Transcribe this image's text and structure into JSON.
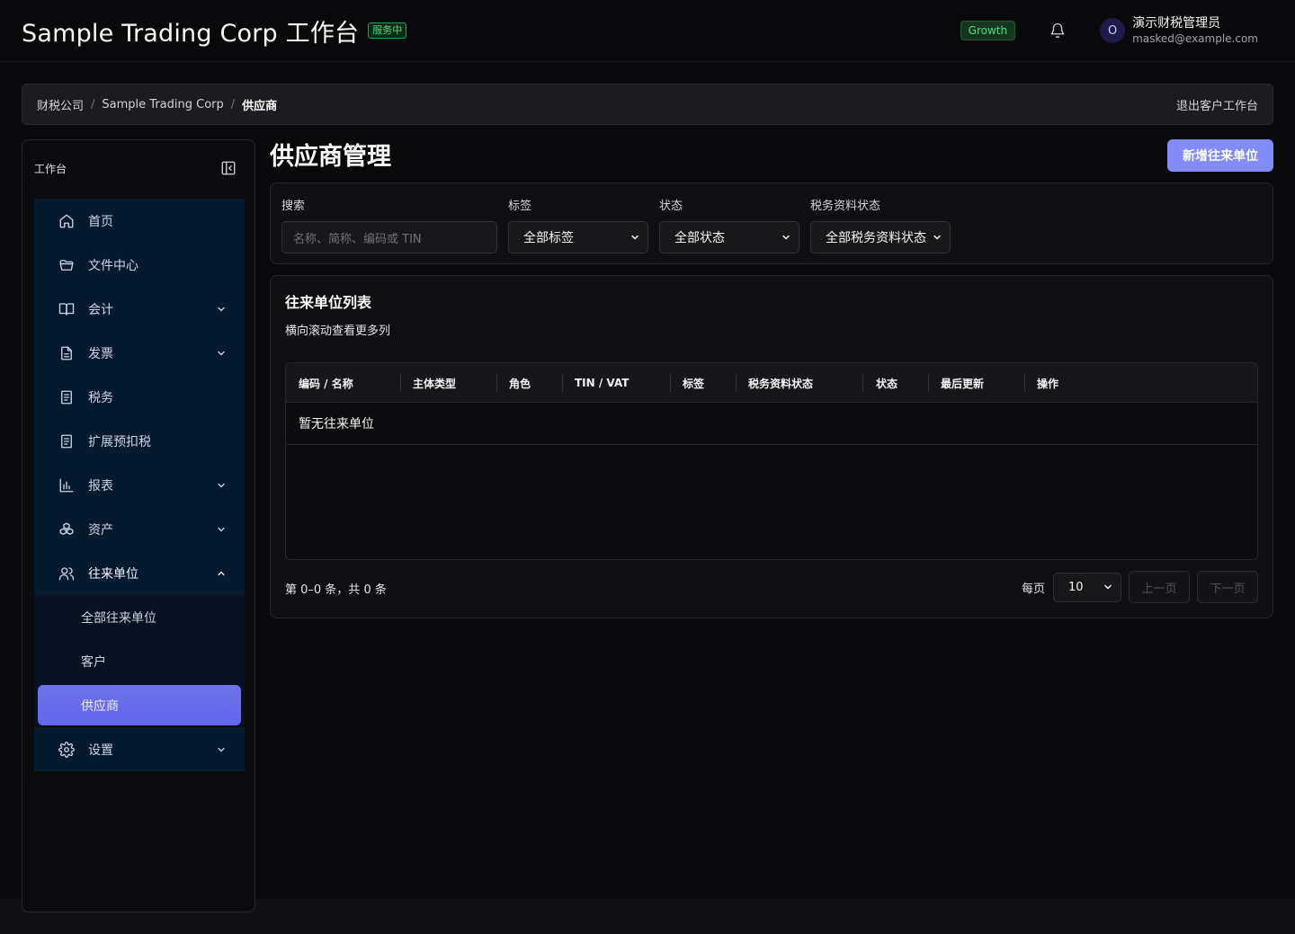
{
  "header": {
    "title": "Sample Trading Corp 工作台",
    "service_badge": "服务中",
    "plan": "Growth",
    "user": {
      "avatar_initial": "O",
      "name": "演示财税管理员",
      "email": "masked@example.com"
    }
  },
  "breadcrumb": {
    "items": [
      "财税公司",
      "Sample Trading Corp",
      "供应商"
    ],
    "separator": "/",
    "exit": "退出客户工作台"
  },
  "sidebar": {
    "title": "工作台",
    "items": [
      {
        "label": "首页",
        "icon": "home-icon"
      },
      {
        "label": "文件中心",
        "icon": "folder-icon"
      },
      {
        "label": "会计",
        "icon": "book-icon"
      },
      {
        "label": "发票",
        "icon": "document-icon"
      },
      {
        "label": "税务",
        "icon": "tax-doc-icon"
      },
      {
        "label": "扩展预扣税",
        "icon": "tax-doc-icon"
      },
      {
        "label": "报表",
        "icon": "bar-chart-icon"
      },
      {
        "label": "资产",
        "icon": "boxes-icon"
      },
      {
        "label": "往来单位",
        "icon": "users-icon"
      }
    ],
    "sub_items": [
      "全部往来单位",
      "客户",
      "供应商"
    ],
    "settings": {
      "label": "设置",
      "icon": "gear-icon"
    }
  },
  "main": {
    "title": "供应商管理",
    "add_button": "新增往来单位",
    "filters": {
      "search_label": "搜索",
      "search_placeholder": "名称、简称、编码或 TIN",
      "tag_label": "标签",
      "tag_value": "全部标签",
      "status_label": "状态",
      "status_value": "全部状态",
      "tax_label": "税务资料状态",
      "tax_value": "全部税务资料状态"
    },
    "list": {
      "title": "往来单位列表",
      "hint": "横向滚动查看更多列",
      "columns": [
        "编码 / 名称",
        "主体类型",
        "角色",
        "TIN / VAT",
        "标签",
        "税务资料状态",
        "状态",
        "最后更新",
        "操作"
      ],
      "empty": "暂无往来单位"
    },
    "pagination": {
      "info": "第 0–0 条，共 0 条",
      "per_page_label": "每页",
      "per_page_value": "10",
      "prev": "上一页",
      "next": "下一页"
    }
  },
  "colors": {
    "accent": "#6366f1",
    "primary_button": "#818cf8",
    "success": "#4ade80",
    "sidebar_bg": "#061a2e"
  }
}
